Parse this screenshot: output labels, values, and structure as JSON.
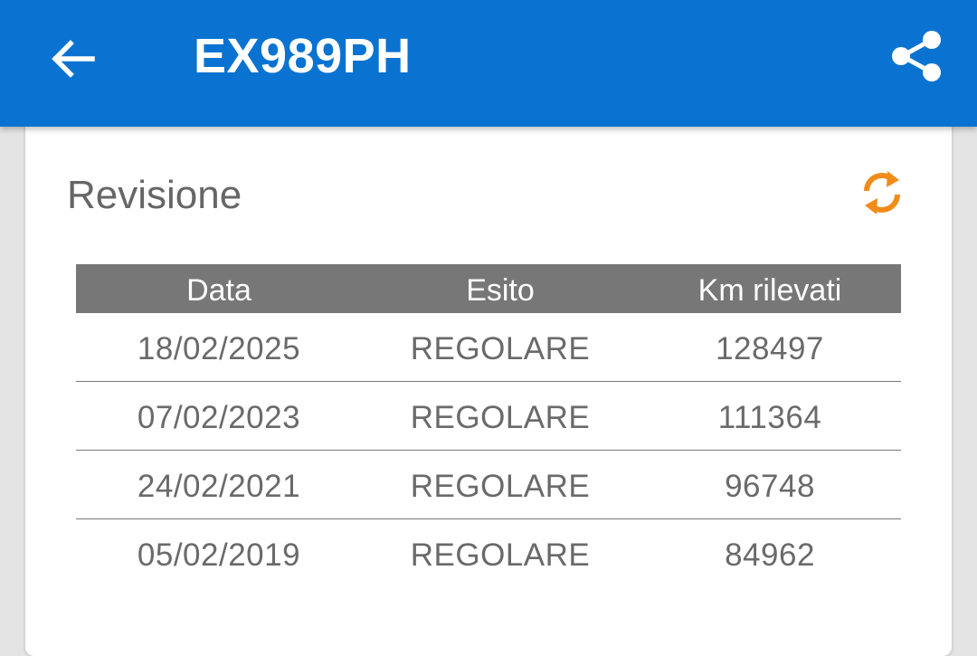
{
  "header": {
    "title": "EX989PH",
    "back_icon": "arrow-left-icon",
    "share_icon": "share-icon",
    "background_color": "#0a73d1"
  },
  "card": {
    "title": "Revisione",
    "refresh_icon": "refresh-icon",
    "refresh_color": "#f08c1a"
  },
  "table": {
    "columns": [
      "Data",
      "Esito",
      "Km rilevati"
    ],
    "rows": [
      {
        "data": "18/02/2025",
        "esito": "REGOLARE",
        "km": "128497"
      },
      {
        "data": "07/02/2023",
        "esito": "REGOLARE",
        "km": "111364"
      },
      {
        "data": "24/02/2021",
        "esito": "REGOLARE",
        "km": "96748"
      },
      {
        "data": "05/02/2019",
        "esito": "REGOLARE",
        "km": "84962"
      }
    ]
  }
}
